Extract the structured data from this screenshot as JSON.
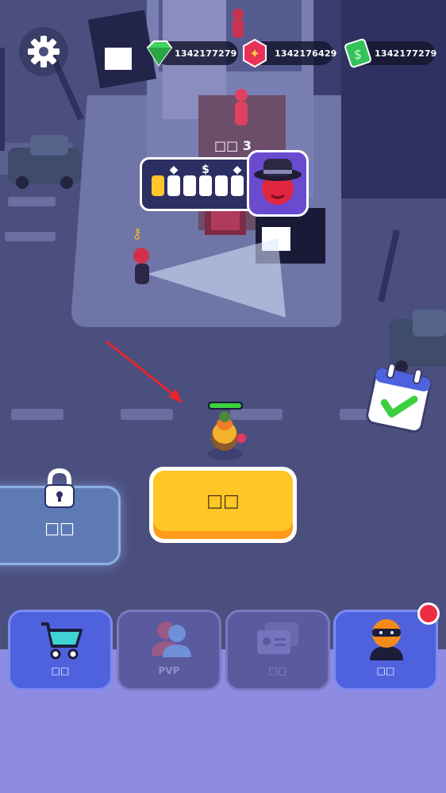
{
  "currencies": {
    "gems": {
      "value": "1342177279",
      "icon": "green-gem-icon",
      "color": "#3fd35a"
    },
    "tokens": {
      "value": "1342176429",
      "icon": "red-token-icon",
      "color": "#e8325a"
    },
    "cash": {
      "value": "1342177279",
      "icon": "cash-stack-icon",
      "color": "#36c25b"
    }
  },
  "settings": {
    "icon": "gear-icon"
  },
  "mission": {
    "level": "□□ 3",
    "slots_filled": 1,
    "slots_total": 6,
    "slot_icons": [
      "◆",
      "$",
      "◆"
    ],
    "boss_icon": "gangster-hat-avatar-icon"
  },
  "main_action": {
    "label": "□□",
    "color": "#ffc726"
  },
  "locked_action": {
    "label": "□□",
    "icon": "padlock-icon"
  },
  "calendar": {
    "icon": "calendar-check-icon"
  },
  "tabs": [
    {
      "label": "□□",
      "icon": "shopping-cart-icon",
      "state": "active"
    },
    {
      "label": "PVP",
      "icon": "players-icon",
      "state": "disabled"
    },
    {
      "label": "□□",
      "icon": "id-cards-icon",
      "state": "disabled"
    },
    {
      "label": "□□",
      "icon": "masked-thief-icon",
      "state": "active"
    }
  ],
  "colors": {
    "tab_active": "#4f62de",
    "tab_disabled": "#5a5a9e",
    "bottom_bar": "#8e8be3"
  }
}
